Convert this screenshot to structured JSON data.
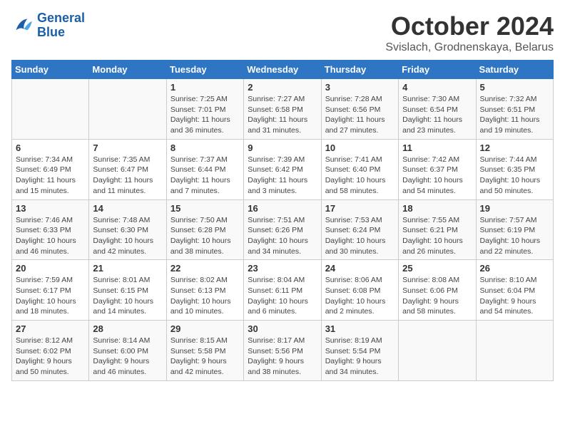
{
  "logo": {
    "line1": "General",
    "line2": "Blue"
  },
  "title": "October 2024",
  "location": "Svislach, Grodnenskaya, Belarus",
  "weekdays": [
    "Sunday",
    "Monday",
    "Tuesday",
    "Wednesday",
    "Thursday",
    "Friday",
    "Saturday"
  ],
  "weeks": [
    [
      {
        "day": "",
        "sunrise": "",
        "sunset": "",
        "daylight": ""
      },
      {
        "day": "",
        "sunrise": "",
        "sunset": "",
        "daylight": ""
      },
      {
        "day": "1",
        "sunrise": "Sunrise: 7:25 AM",
        "sunset": "Sunset: 7:01 PM",
        "daylight": "Daylight: 11 hours and 36 minutes."
      },
      {
        "day": "2",
        "sunrise": "Sunrise: 7:27 AM",
        "sunset": "Sunset: 6:58 PM",
        "daylight": "Daylight: 11 hours and 31 minutes."
      },
      {
        "day": "3",
        "sunrise": "Sunrise: 7:28 AM",
        "sunset": "Sunset: 6:56 PM",
        "daylight": "Daylight: 11 hours and 27 minutes."
      },
      {
        "day": "4",
        "sunrise": "Sunrise: 7:30 AM",
        "sunset": "Sunset: 6:54 PM",
        "daylight": "Daylight: 11 hours and 23 minutes."
      },
      {
        "day": "5",
        "sunrise": "Sunrise: 7:32 AM",
        "sunset": "Sunset: 6:51 PM",
        "daylight": "Daylight: 11 hours and 19 minutes."
      }
    ],
    [
      {
        "day": "6",
        "sunrise": "Sunrise: 7:34 AM",
        "sunset": "Sunset: 6:49 PM",
        "daylight": "Daylight: 11 hours and 15 minutes."
      },
      {
        "day": "7",
        "sunrise": "Sunrise: 7:35 AM",
        "sunset": "Sunset: 6:47 PM",
        "daylight": "Daylight: 11 hours and 11 minutes."
      },
      {
        "day": "8",
        "sunrise": "Sunrise: 7:37 AM",
        "sunset": "Sunset: 6:44 PM",
        "daylight": "Daylight: 11 hours and 7 minutes."
      },
      {
        "day": "9",
        "sunrise": "Sunrise: 7:39 AM",
        "sunset": "Sunset: 6:42 PM",
        "daylight": "Daylight: 11 hours and 3 minutes."
      },
      {
        "day": "10",
        "sunrise": "Sunrise: 7:41 AM",
        "sunset": "Sunset: 6:40 PM",
        "daylight": "Daylight: 10 hours and 58 minutes."
      },
      {
        "day": "11",
        "sunrise": "Sunrise: 7:42 AM",
        "sunset": "Sunset: 6:37 PM",
        "daylight": "Daylight: 10 hours and 54 minutes."
      },
      {
        "day": "12",
        "sunrise": "Sunrise: 7:44 AM",
        "sunset": "Sunset: 6:35 PM",
        "daylight": "Daylight: 10 hours and 50 minutes."
      }
    ],
    [
      {
        "day": "13",
        "sunrise": "Sunrise: 7:46 AM",
        "sunset": "Sunset: 6:33 PM",
        "daylight": "Daylight: 10 hours and 46 minutes."
      },
      {
        "day": "14",
        "sunrise": "Sunrise: 7:48 AM",
        "sunset": "Sunset: 6:30 PM",
        "daylight": "Daylight: 10 hours and 42 minutes."
      },
      {
        "day": "15",
        "sunrise": "Sunrise: 7:50 AM",
        "sunset": "Sunset: 6:28 PM",
        "daylight": "Daylight: 10 hours and 38 minutes."
      },
      {
        "day": "16",
        "sunrise": "Sunrise: 7:51 AM",
        "sunset": "Sunset: 6:26 PM",
        "daylight": "Daylight: 10 hours and 34 minutes."
      },
      {
        "day": "17",
        "sunrise": "Sunrise: 7:53 AM",
        "sunset": "Sunset: 6:24 PM",
        "daylight": "Daylight: 10 hours and 30 minutes."
      },
      {
        "day": "18",
        "sunrise": "Sunrise: 7:55 AM",
        "sunset": "Sunset: 6:21 PM",
        "daylight": "Daylight: 10 hours and 26 minutes."
      },
      {
        "day": "19",
        "sunrise": "Sunrise: 7:57 AM",
        "sunset": "Sunset: 6:19 PM",
        "daylight": "Daylight: 10 hours and 22 minutes."
      }
    ],
    [
      {
        "day": "20",
        "sunrise": "Sunrise: 7:59 AM",
        "sunset": "Sunset: 6:17 PM",
        "daylight": "Daylight: 10 hours and 18 minutes."
      },
      {
        "day": "21",
        "sunrise": "Sunrise: 8:01 AM",
        "sunset": "Sunset: 6:15 PM",
        "daylight": "Daylight: 10 hours and 14 minutes."
      },
      {
        "day": "22",
        "sunrise": "Sunrise: 8:02 AM",
        "sunset": "Sunset: 6:13 PM",
        "daylight": "Daylight: 10 hours and 10 minutes."
      },
      {
        "day": "23",
        "sunrise": "Sunrise: 8:04 AM",
        "sunset": "Sunset: 6:11 PM",
        "daylight": "Daylight: 10 hours and 6 minutes."
      },
      {
        "day": "24",
        "sunrise": "Sunrise: 8:06 AM",
        "sunset": "Sunset: 6:08 PM",
        "daylight": "Daylight: 10 hours and 2 minutes."
      },
      {
        "day": "25",
        "sunrise": "Sunrise: 8:08 AM",
        "sunset": "Sunset: 6:06 PM",
        "daylight": "Daylight: 9 hours and 58 minutes."
      },
      {
        "day": "26",
        "sunrise": "Sunrise: 8:10 AM",
        "sunset": "Sunset: 6:04 PM",
        "daylight": "Daylight: 9 hours and 54 minutes."
      }
    ],
    [
      {
        "day": "27",
        "sunrise": "Sunrise: 8:12 AM",
        "sunset": "Sunset: 6:02 PM",
        "daylight": "Daylight: 9 hours and 50 minutes."
      },
      {
        "day": "28",
        "sunrise": "Sunrise: 8:14 AM",
        "sunset": "Sunset: 6:00 PM",
        "daylight": "Daylight: 9 hours and 46 minutes."
      },
      {
        "day": "29",
        "sunrise": "Sunrise: 8:15 AM",
        "sunset": "Sunset: 5:58 PM",
        "daylight": "Daylight: 9 hours and 42 minutes."
      },
      {
        "day": "30",
        "sunrise": "Sunrise: 8:17 AM",
        "sunset": "Sunset: 5:56 PM",
        "daylight": "Daylight: 9 hours and 38 minutes."
      },
      {
        "day": "31",
        "sunrise": "Sunrise: 8:19 AM",
        "sunset": "Sunset: 5:54 PM",
        "daylight": "Daylight: 9 hours and 34 minutes."
      },
      {
        "day": "",
        "sunrise": "",
        "sunset": "",
        "daylight": ""
      },
      {
        "day": "",
        "sunrise": "",
        "sunset": "",
        "daylight": ""
      }
    ]
  ]
}
